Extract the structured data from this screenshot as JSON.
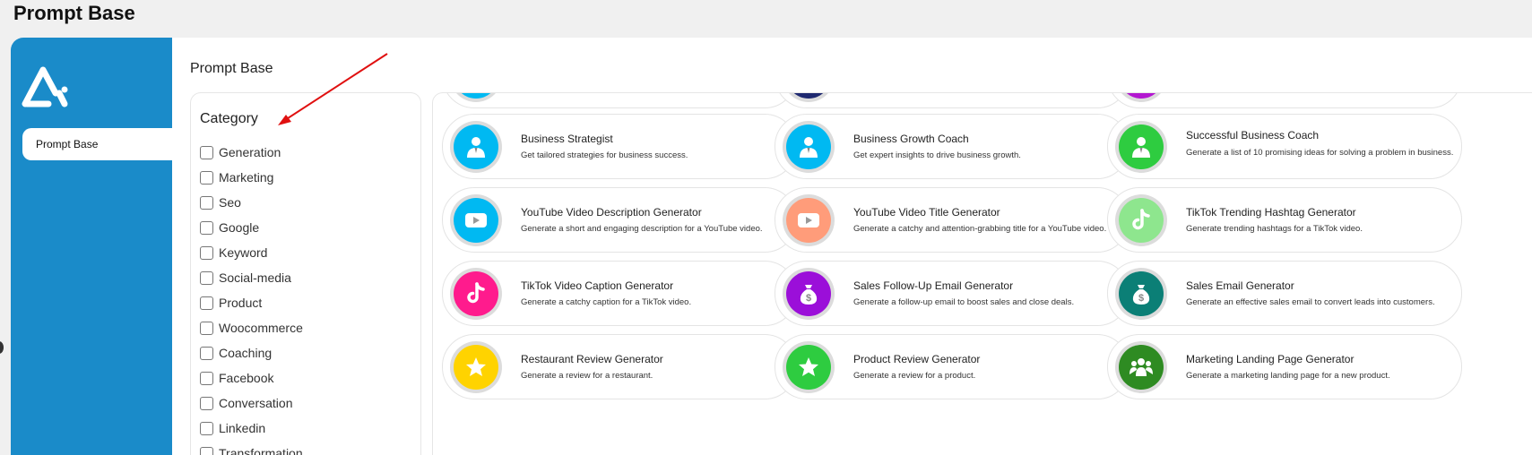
{
  "window": {
    "title": "Prompt Base"
  },
  "sidebar": {
    "items": [
      {
        "label": "Prompt Base"
      }
    ]
  },
  "main": {
    "title": "Prompt Base"
  },
  "categories": {
    "heading": "Category",
    "items": [
      "Generation",
      "Marketing",
      "Seo",
      "Google",
      "Keyword",
      "Social-media",
      "Product",
      "Woocommerce",
      "Coaching",
      "Facebook",
      "Conversation",
      "Linkedin",
      "Transformation"
    ]
  },
  "colors": {
    "sidebar": "#1a8bc9",
    "blue": "#00b9f2",
    "peach": "#ff9c7a",
    "light_green": "#8ee68e",
    "pink": "#ff1b8d",
    "purple": "#9b0fd9",
    "teal": "#0b7f76",
    "yellow": "#ffd300",
    "green": "#2ecc40",
    "dark_green": "#2e8b22",
    "navy": "#1f2970",
    "violet": "#b317d0",
    "arrow": "#e01010"
  },
  "cards": [
    {
      "title": "",
      "desc": "",
      "icon": "none",
      "color": "#00b9f2"
    },
    {
      "title": "",
      "desc": "",
      "icon": "none",
      "color": "#1f2970"
    },
    {
      "title": "",
      "desc": "",
      "icon": "none",
      "color": "#b317d0"
    },
    {
      "title": "Business Strategist",
      "desc": "Get tailored strategies for business success.",
      "icon": "businessman-icon",
      "color": "#00b9f2"
    },
    {
      "title": "Business Growth Coach",
      "desc": "Get expert insights to drive business growth.",
      "icon": "businessman-icon",
      "color": "#00b9f2"
    },
    {
      "title": "Successful Business Coach",
      "desc": "Generate a list of 10 promising ideas for solving a problem in business.",
      "icon": "businessman-icon",
      "color": "#2ecc40"
    },
    {
      "title": "YouTube Video Description Generator",
      "desc": "Generate a short and engaging description for a YouTube video.",
      "icon": "youtube-icon",
      "color": "#00b9f2"
    },
    {
      "title": "YouTube Video Title Generator",
      "desc": "Generate a catchy and attention-grabbing title for a YouTube video.",
      "icon": "youtube-icon",
      "color": "#ff9c7a"
    },
    {
      "title": "TikTok Trending Hashtag Generator",
      "desc": "Generate trending hashtags for a TikTok video.",
      "icon": "tiktok-icon",
      "color": "#8ee68e"
    },
    {
      "title": "TikTok Video Caption Generator",
      "desc": "Generate a catchy caption for a TikTok video.",
      "icon": "tiktok-icon",
      "color": "#ff1b8d"
    },
    {
      "title": "Sales Follow-Up Email Generator",
      "desc": "Generate a follow-up email to boost sales and close deals.",
      "icon": "money-bag-icon",
      "color": "#9b0fd9"
    },
    {
      "title": "Sales Email Generator",
      "desc": "Generate an effective sales email to convert leads into customers.",
      "icon": "money-bag-icon",
      "color": "#0b7f76"
    },
    {
      "title": "Restaurant Review Generator",
      "desc": "Generate a review for a restaurant.",
      "icon": "star-icon",
      "color": "#ffd300"
    },
    {
      "title": "Product Review Generator",
      "desc": "Generate a review for a product.",
      "icon": "star-icon",
      "color": "#2ecc40"
    },
    {
      "title": "Marketing Landing Page Generator",
      "desc": "Generate a marketing landing page for a new product.",
      "icon": "group-icon",
      "color": "#2e8b22"
    }
  ]
}
